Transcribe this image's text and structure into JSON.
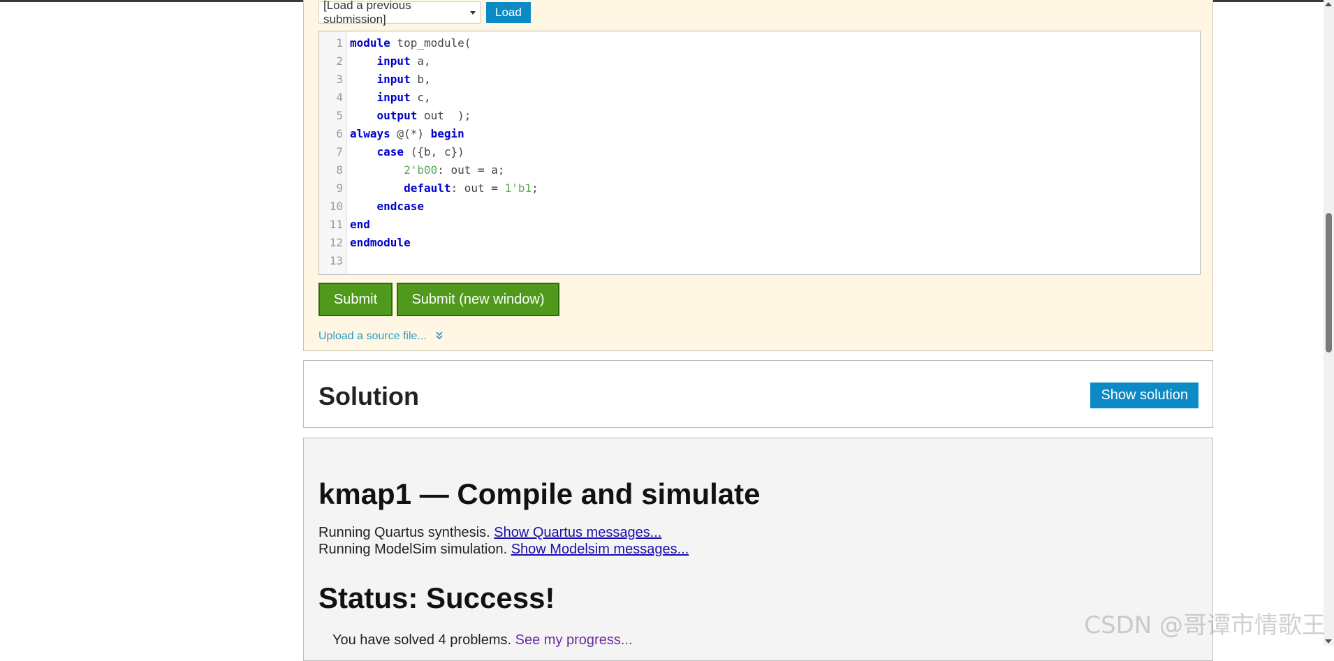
{
  "editor": {
    "load_select_label": "[Load a previous submission]",
    "load_button": "Load",
    "code_lines": [
      {
        "num": "1",
        "tokens": [
          {
            "t": "module",
            "c": "kw"
          },
          {
            "t": " top_module(",
            "c": ""
          }
        ]
      },
      {
        "num": "2",
        "tokens": [
          {
            "t": "    ",
            "c": ""
          },
          {
            "t": "input",
            "c": "kw"
          },
          {
            "t": " a,",
            "c": ""
          }
        ]
      },
      {
        "num": "3",
        "tokens": [
          {
            "t": "    ",
            "c": ""
          },
          {
            "t": "input",
            "c": "kw"
          },
          {
            "t": " b,",
            "c": ""
          }
        ]
      },
      {
        "num": "4",
        "tokens": [
          {
            "t": "    ",
            "c": ""
          },
          {
            "t": "input",
            "c": "kw"
          },
          {
            "t": " c,",
            "c": ""
          }
        ]
      },
      {
        "num": "5",
        "tokens": [
          {
            "t": "    ",
            "c": ""
          },
          {
            "t": "output",
            "c": "kw"
          },
          {
            "t": " out  );",
            "c": ""
          }
        ]
      },
      {
        "num": "6",
        "tokens": [
          {
            "t": "always",
            "c": "kw"
          },
          {
            "t": " @(*) ",
            "c": ""
          },
          {
            "t": "begin",
            "c": "kw"
          }
        ]
      },
      {
        "num": "7",
        "tokens": [
          {
            "t": "    ",
            "c": ""
          },
          {
            "t": "case",
            "c": "kw"
          },
          {
            "t": " ({b, c})",
            "c": ""
          }
        ]
      },
      {
        "num": "8",
        "tokens": [
          {
            "t": "        ",
            "c": ""
          },
          {
            "t": "2'b00",
            "c": "num"
          },
          {
            "t": ": out = a;",
            "c": ""
          }
        ]
      },
      {
        "num": "9",
        "tokens": [
          {
            "t": "        ",
            "c": ""
          },
          {
            "t": "default",
            "c": "kw"
          },
          {
            "t": ": out = ",
            "c": ""
          },
          {
            "t": "1'b1",
            "c": "num"
          },
          {
            "t": ";",
            "c": ""
          }
        ]
      },
      {
        "num": "10",
        "tokens": [
          {
            "t": "    ",
            "c": ""
          },
          {
            "t": "endcase",
            "c": "kw"
          }
        ]
      },
      {
        "num": "11",
        "tokens": [
          {
            "t": "end",
            "c": "kw"
          }
        ]
      },
      {
        "num": "12",
        "tokens": [
          {
            "t": "endmodule",
            "c": "kw"
          }
        ]
      },
      {
        "num": "13",
        "tokens": []
      }
    ],
    "submit_label": "Submit",
    "submit_new_window_label": "Submit (new window)",
    "upload_label": "Upload a source file...",
    "upload_icon": "double-chevron-down-icon"
  },
  "solution": {
    "title": "Solution",
    "show_button": "Show solution"
  },
  "results": {
    "title": "kmap1 — Compile and simulate",
    "quartus_text": "Running Quartus synthesis.",
    "quartus_link": "Show Quartus messages...",
    "modelsim_text": "Running ModelSim simulation.",
    "modelsim_link": "Show Modelsim messages...",
    "status": "Status: Success!",
    "progress_text": "You have solved 4 problems.",
    "progress_link": "See my progress..."
  },
  "watermark": "CSDN @哥谭市情歌王",
  "colors": {
    "accent_blue": "#0b8ac5",
    "submit_green": "#4f9a1c",
    "panel_cream": "#fff6e3",
    "results_gray": "#f4f4f4"
  }
}
